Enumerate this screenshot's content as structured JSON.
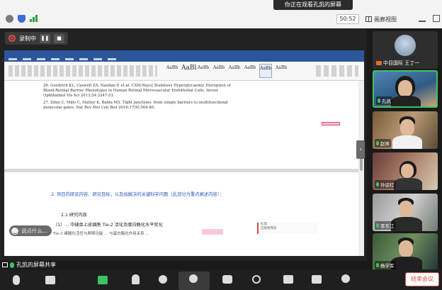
{
  "topbar": {
    "viewing_banner": "你正在观看孔凯的屏幕",
    "timer": "50:52",
    "view_label": "画廊视图"
  },
  "recording": {
    "status": "录制中"
  },
  "document": {
    "references": [
      "26.  Goodrich KL, Caswell ZA, Nandan P, et al. CXM-Rays] Stabilises Hyperglycaemic Disruption of Blood-Retinal Barrier Phenotypes in Human Retinal Microvascular Endothelial Cells. Invest Ophthalmol Vis Sci 2013;54:3347-53.",
      "27.  Zihni C, Mills C, Matter K, Balda MS. Tight junctions: from simple barriers to multifunctional molecular gates. Nat Rev Mol Cell Biol 2016;17(9):564-80."
    ],
    "section_heading": "2. 项目的研究内容、研究目标，以及拟解决的关键科学问题（此部分为重点阐述内容）：",
    "subheading": "2.1 研究内容",
    "body_lines": [
      "（1）... 中缝单上皮细胞 Tie-2 活化及蛋白酶化水平变化",
      "Tie-2 磷酸化活性与屏障功能 ... 与蛋白酶化作用关系 ..."
    ],
    "comment_author": "孔凯",
    "comment_text": "已修改完毕"
  },
  "chat": {
    "placeholder": "说点什么..."
  },
  "share_label": "孔凯的屏幕共享",
  "participants": [
    {
      "name": "中目国际 王丁一",
      "camera": false
    },
    {
      "name": "孔凯",
      "active": true
    },
    {
      "name": "赵男"
    },
    {
      "name": "孙运红"
    },
    {
      "name": "李东江"
    },
    {
      "name": "杨学军"
    }
  ],
  "toolbar": {
    "end_label": "结束会议"
  },
  "colors": {
    "accent_green": "#3fc35f",
    "end_red": "#e04a4a",
    "word_blue": "#2b579a",
    "heading_blue": "#2e5bb7"
  }
}
